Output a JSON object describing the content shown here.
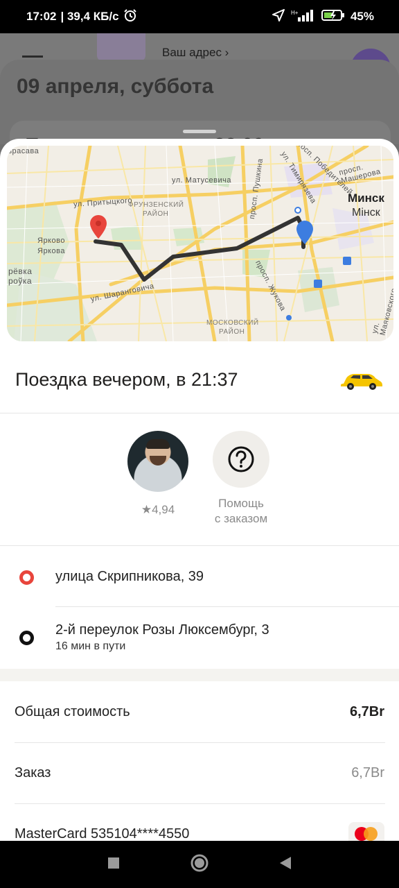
{
  "status_bar": {
    "time": "17:02",
    "network_speed": "| 39,4 КБ/с",
    "battery": "45%",
    "icons": [
      "alarm-icon",
      "location-arrow-icon",
      "signal-icon",
      "battery-icon"
    ]
  },
  "background_screen": {
    "address_label": "Ваш адрес",
    "date_heading": "09 апреля, суббота",
    "trip_title": "Поездка вечером, в 22:09"
  },
  "map": {
    "labels": {
      "district1": "ФРУНЗЕНСКИЙ",
      "district1b": "РАЙОН",
      "district2": "МОСКОВСКИЙ",
      "district2b": "РАЙОН",
      "city": "Минск",
      "city_alt": "Мінск",
      "village": "Ярково",
      "village_alt": "Яркова",
      "street1": "ул. Притыцкого",
      "street2": "ул. Матусевича",
      "street3": "просп. Пушкина",
      "street4": "ул. Шаранговича",
      "street5": "просп. Жукова",
      "street6": "ул. Тимирязева",
      "street7": "просп. Победителей",
      "street8": "просп. Машерова",
      "street9": "ул. Маяковского",
      "edge1": "зрасава",
      "edge2": "рёвка",
      "edge3": "роўка"
    }
  },
  "trip": {
    "title": "Поездка вечером, в 21:37",
    "car_icon": "taxi-car-icon"
  },
  "driver": {
    "rating": "4,94",
    "star": "★"
  },
  "help": {
    "label_line1": "Помощь",
    "label_line2": "с заказом"
  },
  "route": {
    "from": "улица Скрипникова, 39",
    "to": "2-й переулок Розы Люксембург, 3",
    "duration": "16 мин в пути"
  },
  "payment": {
    "total_label": "Общая стоимость",
    "total_value": "6,7Br",
    "order_label": "Заказ",
    "order_value": "6,7Br",
    "card_label": "MasterCard 535104****4550"
  },
  "colors": {
    "accent_red": "#e8453c",
    "route_line": "#333333",
    "destination_pin": "#3d7de0",
    "taxi_yellow": "#f5c400"
  }
}
